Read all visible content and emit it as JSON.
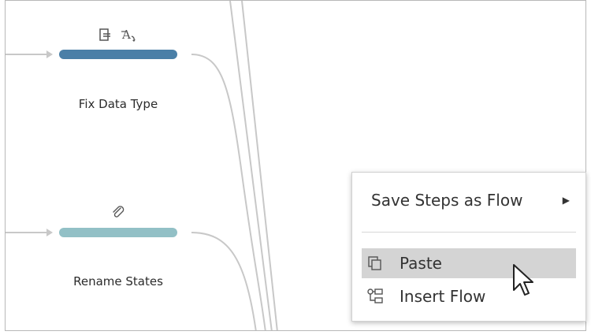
{
  "steps": [
    {
      "label": "Fix Data Type",
      "color": "#4a7fa7",
      "icons": [
        "column-change-icon",
        "data-type-icon"
      ]
    },
    {
      "label": "Rename States",
      "color": "#92c0c6",
      "icons": [
        "paperclip-icon"
      ]
    }
  ],
  "context_menu": {
    "items": [
      {
        "label": "Save Steps as Flow",
        "has_submenu": true,
        "highlighted": false,
        "icon": ""
      },
      {
        "label": "Paste",
        "has_submenu": false,
        "highlighted": true,
        "icon": "paste-icon"
      },
      {
        "label": "Insert Flow",
        "has_submenu": false,
        "highlighted": false,
        "icon": "insert-flow-icon"
      }
    ]
  },
  "colors": {
    "connector": "#c8c8c8",
    "menu_highlight": "#d4d4d4"
  }
}
